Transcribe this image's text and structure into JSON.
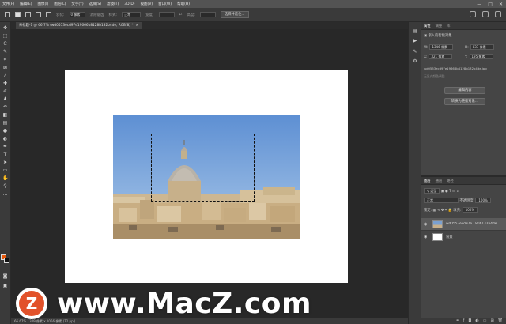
{
  "menu": {
    "items": [
      "文件(F)",
      "编辑(E)",
      "图像(I)",
      "图层(L)",
      "文字(Y)",
      "选择(S)",
      "滤镜(T)",
      "3D(D)",
      "视图(V)",
      "窗口(W)",
      "帮助(H)"
    ],
    "window_controls": [
      "—",
      "□",
      "✕"
    ]
  },
  "options": {
    "feather_label": "羽化:",
    "feather_value": "0 像素",
    "antialias_label": "消除锯齿",
    "style_label": "样式:",
    "style_value": "正常",
    "width_label": "宽度:",
    "height_label": "高度:",
    "select_mask_button": "选择并遮住..."
  },
  "document": {
    "tab_title": "未标题-1 @ 66.7% (wd0553ecd97e19666b8128b132b4de, RGB/8) *",
    "close": "×",
    "status": "66.67%    1349 像素 x 1056 像素 (72 ppi)"
  },
  "properties": {
    "tabs": [
      "属性",
      "调整",
      "库"
    ],
    "section_title": "嵌入的智能对象",
    "w_label": "W:",
    "w_value": "1346 像素",
    "h_label": "H:",
    "h_value": "837 像素",
    "x_label": "X:",
    "x_value": "321 像素",
    "y_label": "Y:",
    "y_value": "195 像素",
    "filename": "wd0553ecd97e19666b8128b132b4de.jpg",
    "placeholder": "无显式颜色调整",
    "edit_button": "编辑内容",
    "convert_button": "转换为链接对象..."
  },
  "layers": {
    "tabs": [
      "图层",
      "通道",
      "路径"
    ],
    "filter_label": "类型",
    "blend_mode": "正常",
    "opacity_label": "不透明度:",
    "opacity_value": "100%",
    "lock_label": "锁定:",
    "fill_label": "填充:",
    "fill_value": "100%",
    "items": [
      {
        "name": "wd0553ecd97e...80b132b4de",
        "thumb": "image",
        "visible": true,
        "selected": true
      },
      {
        "name": "背景",
        "thumb": "white",
        "visible": true,
        "selected": false
      }
    ],
    "footer_icons": [
      "link-icon",
      "fx-icon",
      "mask-icon",
      "adjustment-icon",
      "folder-icon",
      "new-layer-icon",
      "trash-icon"
    ]
  },
  "watermark": {
    "logo_letter": "Z",
    "text": "www.MacZ.com"
  },
  "colors": {
    "foreground": "#e8590c",
    "background": "#111111"
  }
}
